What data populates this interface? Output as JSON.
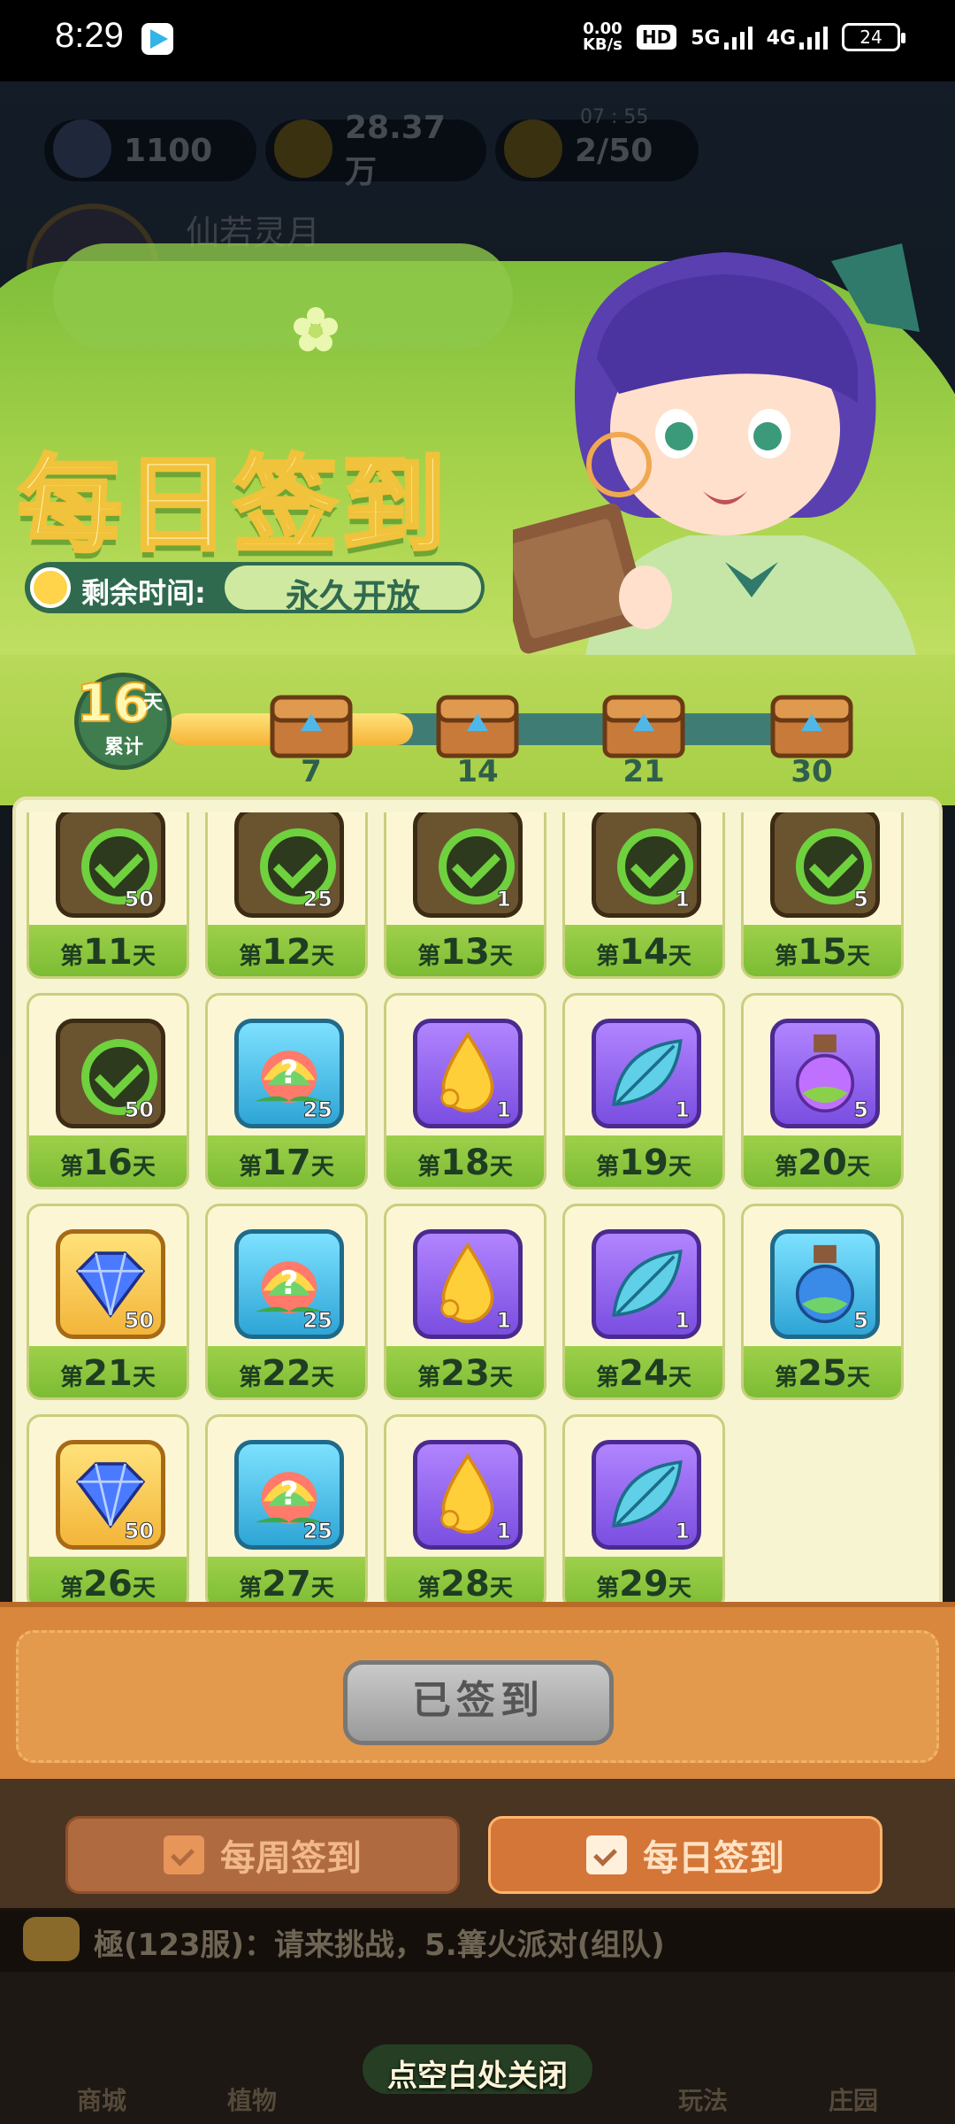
{
  "status_bar": {
    "time": "8:29",
    "speed_value": "0.00",
    "speed_unit": "KB/s",
    "hd": "HD",
    "net1": "5G",
    "net2": "4G",
    "battery": "24"
  },
  "background": {
    "resources": [
      {
        "name": "diamond-icon",
        "value": "1100"
      },
      {
        "name": "coin-icon",
        "value": "28.37万"
      },
      {
        "name": "energy-icon",
        "value": "2/50"
      }
    ],
    "energy_timer": "07 : 55",
    "player_name": "仙若灵月"
  },
  "banner": {
    "title": "每日签到",
    "time_label": "剩余时间:",
    "time_value": "永久开放"
  },
  "progress": {
    "days": "16",
    "days_unit": "天",
    "cumulative_label": "累计",
    "fill_fraction": 0.36,
    "milestones": [
      "7",
      "14",
      "21",
      "30"
    ]
  },
  "grid": {
    "day_prefix": "第",
    "day_suffix": "天",
    "cells": [
      {
        "day": "11",
        "item": "check",
        "qty": "50",
        "claimed": true
      },
      {
        "day": "12",
        "item": "check",
        "qty": "25",
        "claimed": true
      },
      {
        "day": "13",
        "item": "check",
        "qty": "1",
        "claimed": true
      },
      {
        "day": "14",
        "item": "check",
        "qty": "1",
        "claimed": true
      },
      {
        "day": "15",
        "item": "check",
        "qty": "5",
        "claimed": true
      },
      {
        "day": "16",
        "item": "check",
        "qty": "50",
        "claimed": true
      },
      {
        "day": "17",
        "item": "rainbow-seed",
        "qty": "25",
        "claimed": false
      },
      {
        "day": "18",
        "item": "gold-drop",
        "qty": "1",
        "claimed": false
      },
      {
        "day": "19",
        "item": "crystal-leaf",
        "qty": "1",
        "claimed": false
      },
      {
        "day": "20",
        "item": "purple-potion",
        "qty": "5",
        "claimed": false
      },
      {
        "day": "21",
        "item": "diamond",
        "qty": "50",
        "claimed": false
      },
      {
        "day": "22",
        "item": "rainbow-seed",
        "qty": "25",
        "claimed": false
      },
      {
        "day": "23",
        "item": "gold-drop",
        "qty": "1",
        "claimed": false
      },
      {
        "day": "24",
        "item": "crystal-leaf",
        "qty": "1",
        "claimed": false
      },
      {
        "day": "25",
        "item": "blue-potion",
        "qty": "5",
        "claimed": false
      },
      {
        "day": "26",
        "item": "diamond",
        "qty": "50",
        "claimed": false
      },
      {
        "day": "27",
        "item": "rainbow-seed",
        "qty": "25",
        "claimed": false
      },
      {
        "day": "28",
        "item": "gold-drop",
        "qty": "1",
        "claimed": false
      },
      {
        "day": "29",
        "item": "crystal-leaf",
        "qty": "1",
        "claimed": false
      }
    ]
  },
  "signed_button": "已签到",
  "tabs": {
    "weekly": "每周签到",
    "daily": "每日签到"
  },
  "chat": {
    "text": "極(123服)：请来挑战，5.篝火派对(组队)"
  },
  "nav": {
    "items": [
      "商城",
      "植物",
      "",
      "",
      "玩法",
      "庄园"
    ]
  },
  "close_hint": "点空白处关闭"
}
